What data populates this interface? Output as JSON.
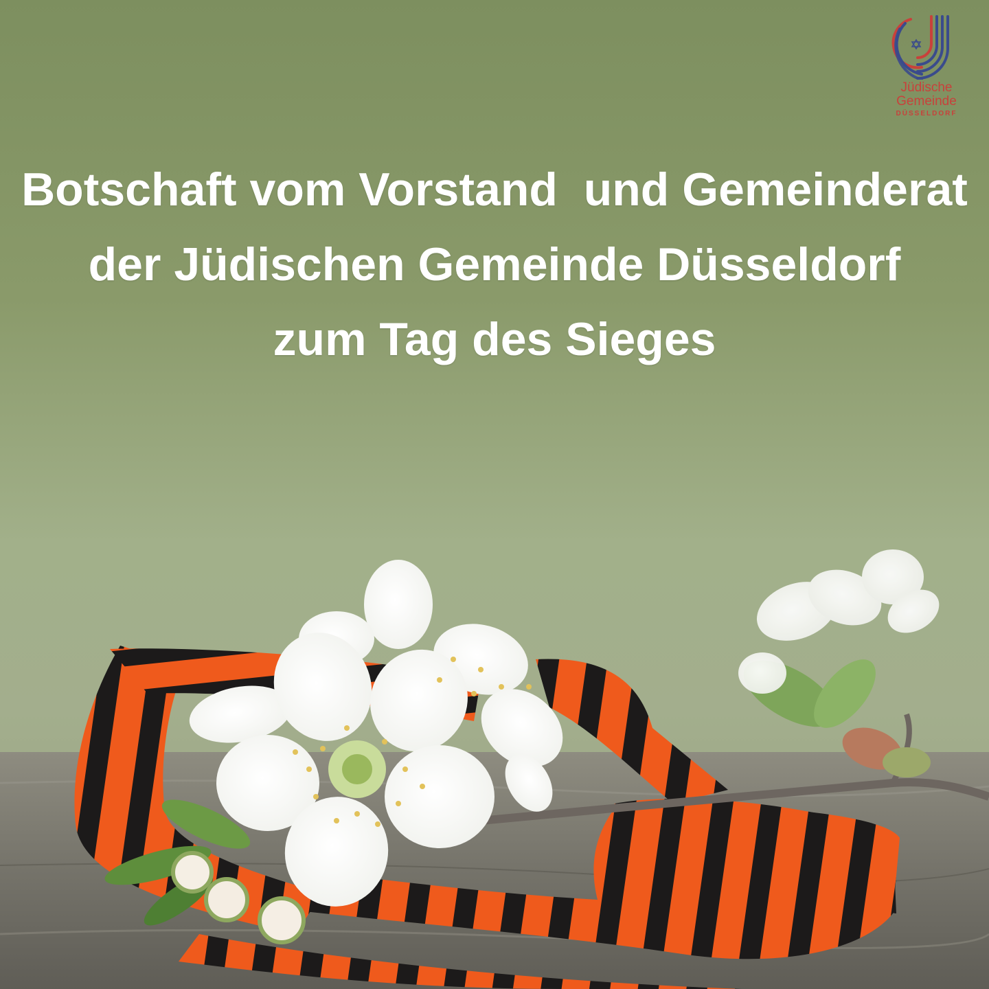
{
  "headline": {
    "line1": "Botschaft vom Vorstand  und Gemeinderat",
    "line2": "der Jüdischen Gemeinde Düsseldorf",
    "line3": "zum Tag des Sieges"
  },
  "logo": {
    "line1": "Jüdische",
    "line2": "Gemeinde",
    "line3": "DÜSSELDORF",
    "icon": "menorah-arc-logo-icon"
  },
  "colors": {
    "background_top": "#7d8f5f",
    "background_mid": "#a3ae8d",
    "ribbon_orange": "#ef5a1c",
    "ribbon_black": "#1a1818",
    "logo_red": "#c8413b",
    "logo_blue": "#3a4b8c",
    "text": "#ffffff"
  }
}
